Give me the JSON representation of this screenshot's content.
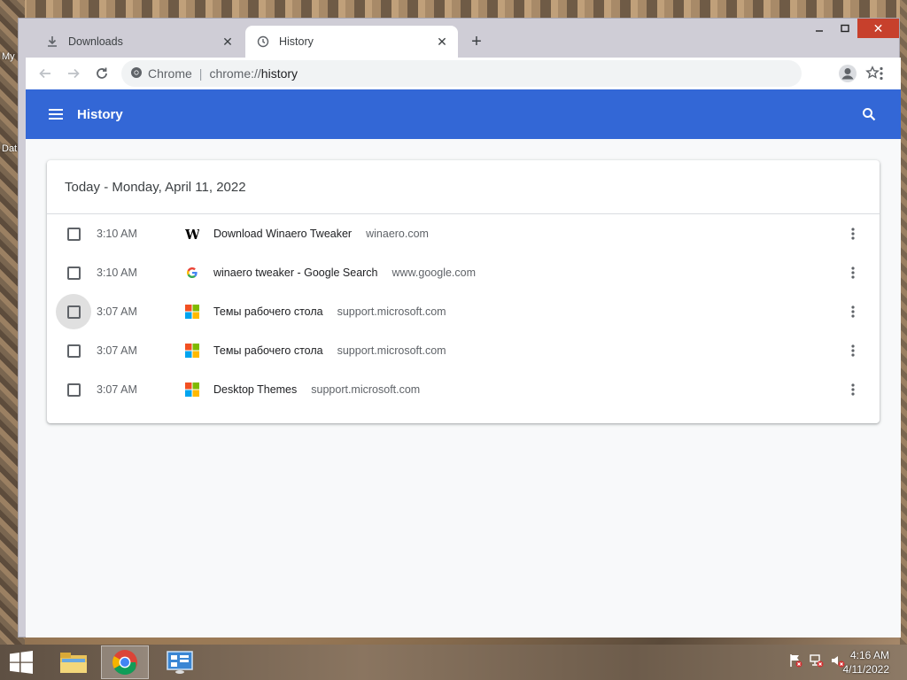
{
  "desktop": {
    "labels": [
      "My",
      "Dat"
    ]
  },
  "tabs": [
    {
      "label": "Downloads",
      "icon": "download-icon",
      "active": false
    },
    {
      "label": "History",
      "icon": "history-icon",
      "active": true
    }
  ],
  "window_controls": {
    "minimize": "minimize",
    "maximize": "maximize",
    "close": "close"
  },
  "omnibox": {
    "site_label": "Chrome",
    "url_scheme": "chrome://",
    "url_host": "history"
  },
  "header": {
    "title": "History"
  },
  "card": {
    "title": "Today - Monday, April 11, 2022",
    "entries": [
      {
        "time": "3:10 AM",
        "title": "Download Winaero Tweaker",
        "domain": "winaero.com",
        "favicon": "winaero-icon"
      },
      {
        "time": "3:10 AM",
        "title": "winaero tweaker - Google Search",
        "domain": "www.google.com",
        "favicon": "google-icon"
      },
      {
        "time": "3:07 AM",
        "title": "Темы рабочего стола",
        "domain": "support.microsoft.com",
        "favicon": "microsoft-icon"
      },
      {
        "time": "3:07 AM",
        "title": "Темы рабочего стола",
        "domain": "support.microsoft.com",
        "favicon": "microsoft-icon"
      },
      {
        "time": "3:07 AM",
        "title": "Desktop Themes",
        "domain": "support.microsoft.com",
        "favicon": "microsoft-icon"
      }
    ]
  },
  "taskbar": {
    "time": "4:16 AM",
    "date": "4/11/2022"
  },
  "colors": {
    "header_blue": "#3367d6",
    "close_red": "#c7402c"
  }
}
